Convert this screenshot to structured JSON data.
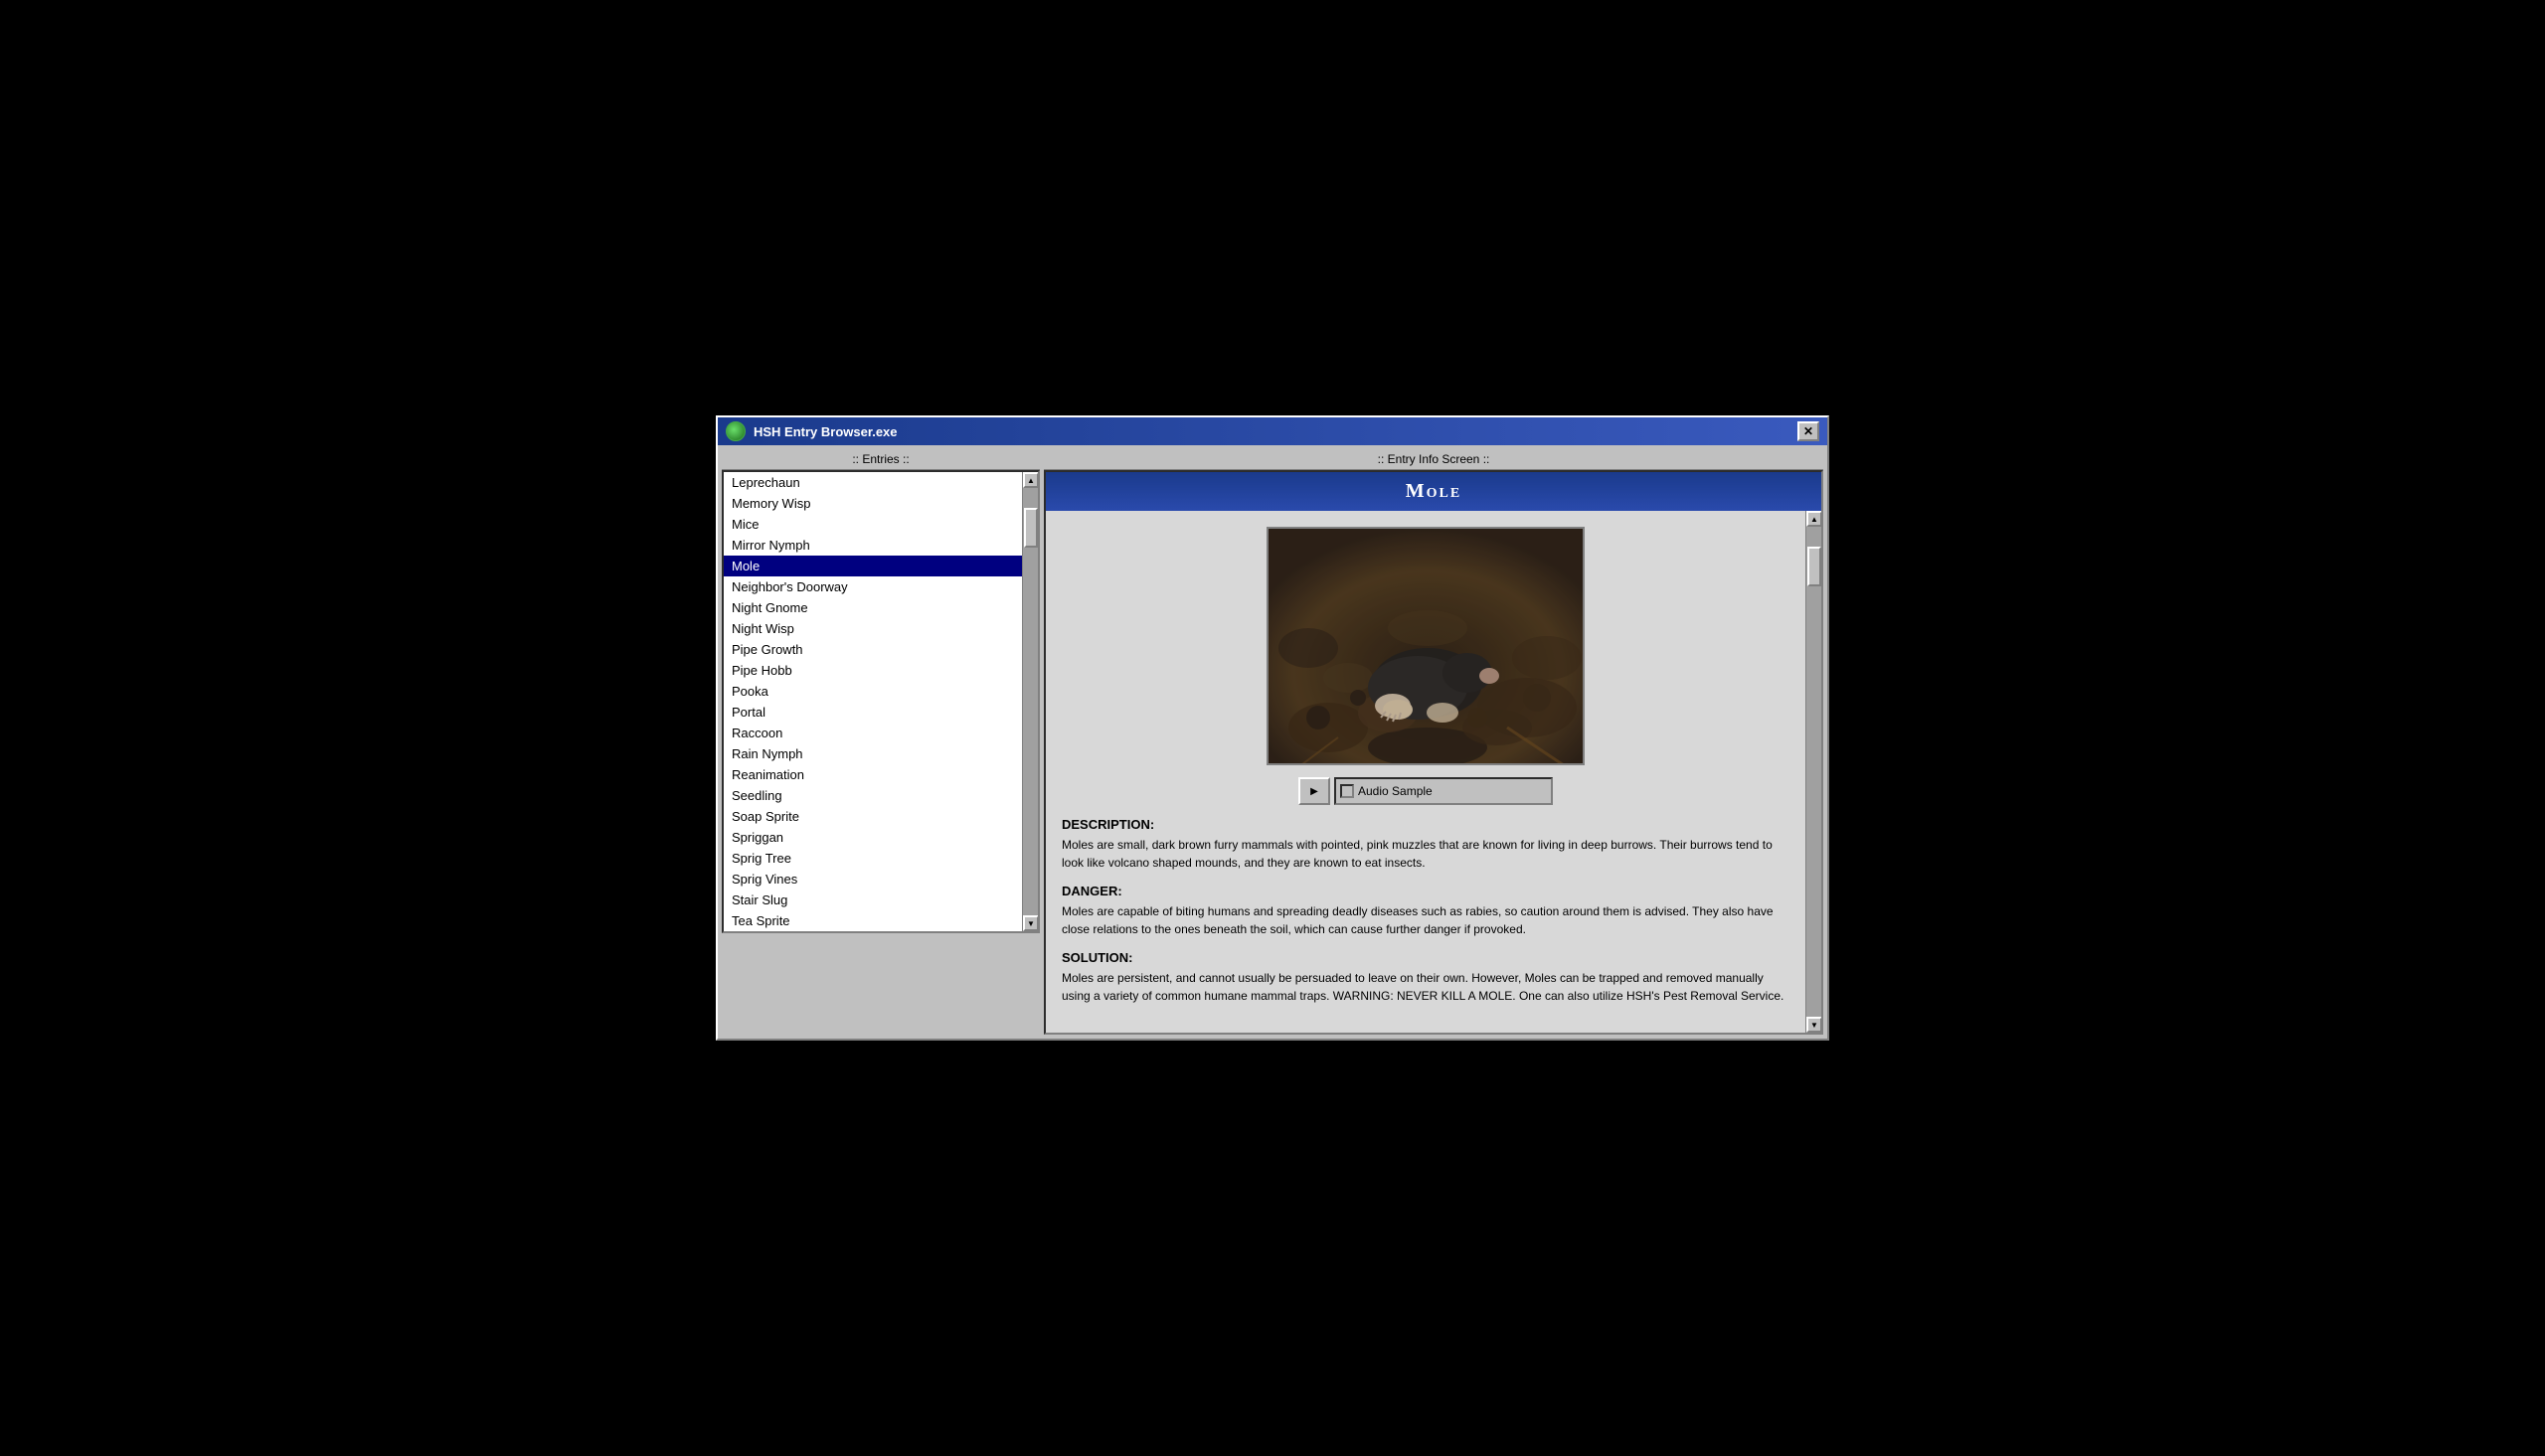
{
  "window": {
    "title": "HSH Entry Browser.exe",
    "close_label": "✕"
  },
  "panels": {
    "left_header": ":: Entries ::",
    "right_header": ":: Entry Info Screen ::"
  },
  "entries": [
    {
      "id": "leprechaun",
      "label": "Leprechaun",
      "selected": false
    },
    {
      "id": "memory-wisp",
      "label": "Memory Wisp",
      "selected": false
    },
    {
      "id": "mice",
      "label": "Mice",
      "selected": false
    },
    {
      "id": "mirror-nymph",
      "label": "Mirror Nymph",
      "selected": false
    },
    {
      "id": "mole",
      "label": "Mole",
      "selected": true
    },
    {
      "id": "neighbors-doorway",
      "label": "Neighbor's Doorway",
      "selected": false
    },
    {
      "id": "night-gnome",
      "label": "Night Gnome",
      "selected": false
    },
    {
      "id": "night-wisp",
      "label": "Night Wisp",
      "selected": false
    },
    {
      "id": "pipe-growth",
      "label": "Pipe Growth",
      "selected": false
    },
    {
      "id": "pipe-hobb",
      "label": "Pipe Hobb",
      "selected": false
    },
    {
      "id": "pooka",
      "label": "Pooka",
      "selected": false
    },
    {
      "id": "portal",
      "label": "Portal",
      "selected": false
    },
    {
      "id": "raccoon",
      "label": "Raccoon",
      "selected": false
    },
    {
      "id": "rain-nymph",
      "label": "Rain Nymph",
      "selected": false
    },
    {
      "id": "reanimation",
      "label": "Reanimation",
      "selected": false
    },
    {
      "id": "seedling",
      "label": "Seedling",
      "selected": false
    },
    {
      "id": "soap-sprite",
      "label": "Soap Sprite",
      "selected": false
    },
    {
      "id": "spriggan",
      "label": "Spriggan",
      "selected": false
    },
    {
      "id": "sprig-tree",
      "label": "Sprig Tree",
      "selected": false
    },
    {
      "id": "sprig-vines",
      "label": "Sprig Vines",
      "selected": false
    },
    {
      "id": "stair-slug",
      "label": "Stair Slug",
      "selected": false
    },
    {
      "id": "tea-sprite",
      "label": "Tea Sprite",
      "selected": false
    }
  ],
  "entry": {
    "title": "Mole",
    "audio_label": "Audio Sample",
    "play_label": "▶",
    "description_header": "DESCRIPTION:",
    "description_text": "Moles are small, dark brown furry mammals with pointed, pink muzzles that are known for living in deep burrows. Their burrows tend to look like volcano shaped mounds, and they are known to eat insects.",
    "danger_header": "DANGER:",
    "danger_text": "Moles are capable of biting humans and spreading deadly diseases such as rabies, so caution around them is advised. They also have close relations to the ones beneath the soil, which can cause further danger if provoked.",
    "solution_header": "SOLUTION:",
    "solution_text": "Moles are persistent, and cannot usually be persuaded to leave on their own. However, Moles can be trapped and removed manually using a variety of common humane mammal traps. WARNING: NEVER KILL A MOLE. One can also utilize HSH's Pest Removal Service."
  }
}
